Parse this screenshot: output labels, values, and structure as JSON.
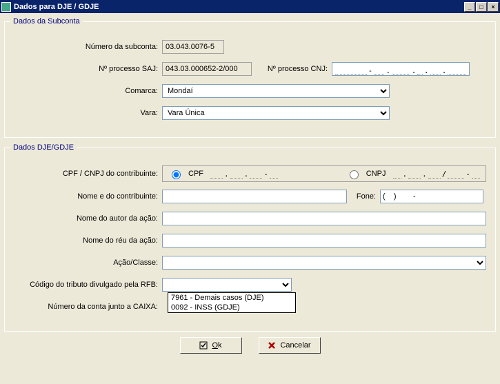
{
  "window": {
    "title": "Dados para DJE / GDJE"
  },
  "groups": {
    "subconta": "Dados da Subconta",
    "dje": "Dados DJE/GDJE"
  },
  "subconta": {
    "numero_label": "Número da subconta:",
    "numero_value": "03.043.0076-5",
    "proc_saj_label": "Nº processo SAJ:",
    "proc_saj_value": "043.03.000652-2/000",
    "proc_cnj_label": "Nº processo CNJ:",
    "proc_cnj_value": "",
    "comarca_label": "Comarca:",
    "comarca_value": "Mondaí",
    "vara_label": "Vara:",
    "vara_value": "Vara Única"
  },
  "dje": {
    "cpfcnpj_label": "CPF / CNPJ do contribuinte:",
    "radio_cpf": "CPF",
    "radio_cnpj": "CNPJ",
    "cpf_mask": "___.___.___-__",
    "cnpj_mask": "__.___.___/____-__",
    "nome_contrib_label": "Nome e do contribuinte:",
    "nome_contrib_value": "",
    "fone_label": "Fone:",
    "fone_value": "(    )        -",
    "autor_label": "Nome do autor da ação:",
    "autor_value": "",
    "reu_label": "Nome do réu da ação:",
    "reu_value": "",
    "acao_label": "Ação/Classe:",
    "acao_value": "",
    "tributo_label": "Código do tributo divulgado pela RFB:",
    "tributo_value": "",
    "tributo_options": [
      "7961 - Demais casos (DJE)",
      "0092 - INSS (GDJE)"
    ],
    "caixa_label": "Número da conta junto a CAIXA:"
  },
  "buttons": {
    "ok": "Ok",
    "cancel": "Cancelar"
  }
}
